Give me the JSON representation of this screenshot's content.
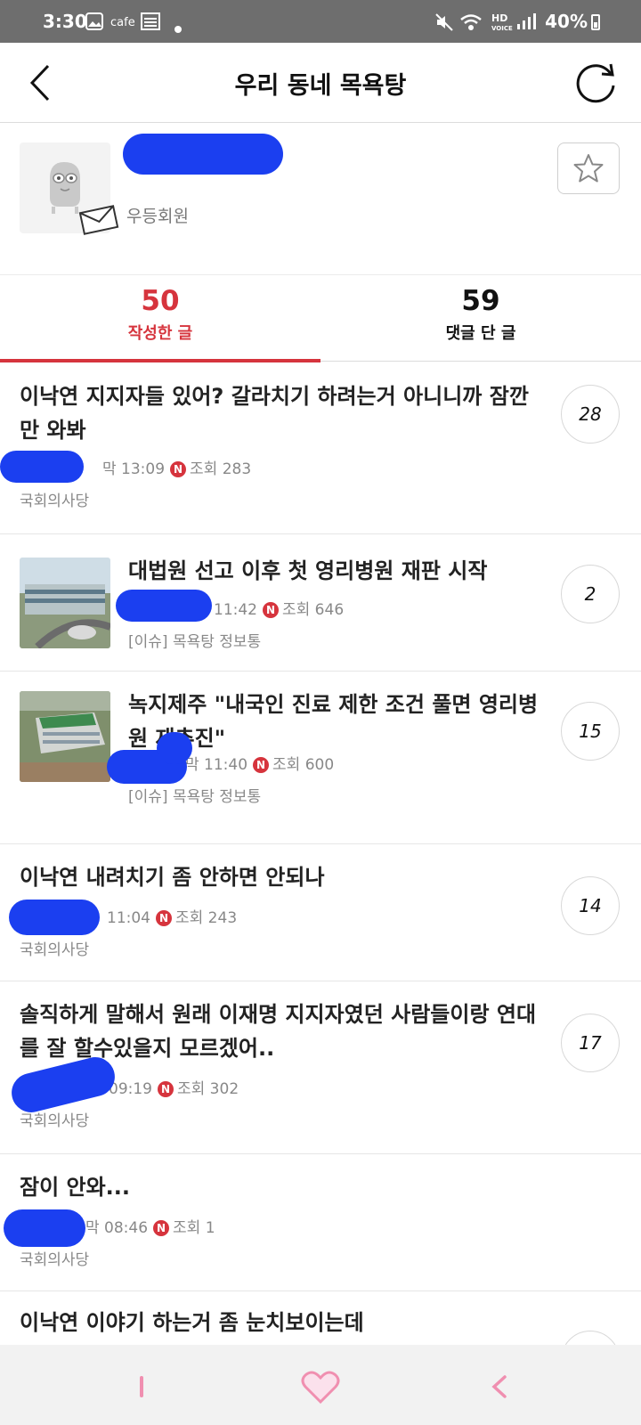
{
  "status_bar": {
    "time": "3:30",
    "app_label": "cafe",
    "battery": "40%"
  },
  "header": {
    "title": "우리 동네 목욕탕"
  },
  "profile": {
    "member_grade": "우등회원"
  },
  "tabs": [
    {
      "count": "50",
      "label": "작성한 글",
      "active": true
    },
    {
      "count": "59",
      "label": "댓글 단 글",
      "active": false
    }
  ],
  "posts": [
    {
      "title": "이낙연 지지자들 있어? 갈라치기 하려는거 아니니까 잠깐만 와봐",
      "time": "막 13:09",
      "views": "조회 283",
      "board": "국회의사당",
      "comments": "28"
    },
    {
      "title": "대법원 선고 이후 첫 영리병원 재판 시작",
      "time": "11:42",
      "views": "조회 646",
      "board": "[이슈] 목욕탕 정보통",
      "comments": "2"
    },
    {
      "title": "녹지제주 \"내국인 진료 제한 조건 풀면 영리병원 재추진\"",
      "time": "막 11:40",
      "views": "조회 600",
      "board": "[이슈] 목욕탕 정보통",
      "comments": "15"
    },
    {
      "title": "이낙연 내려치기 좀 안하면 안되나",
      "time": "11:04",
      "views": "조회 243",
      "board": "국회의사당",
      "comments": "14"
    },
    {
      "title": "솔직하게 말해서 원래 이재명 지지자였던 사람들이랑 연대를 잘 할수있을지 모르겠어..",
      "time": "09:19",
      "views": "조회 302",
      "board": "국회의사당",
      "comments": "17"
    },
    {
      "title": "잠이 안와...",
      "time": "막 08:46",
      "views": "조회 1",
      "board": "국회의사당",
      "comments": ""
    },
    {
      "title": "이낙연 이야기 하는거 좀 눈치보이는데",
      "time": "",
      "views": "",
      "board": "",
      "comments": ""
    }
  ],
  "icons": {
    "back": "chevron-left-icon",
    "refresh": "refresh-icon",
    "favorite": "star-icon",
    "mail": "mail-icon",
    "nav_recent": "recent-apps-icon",
    "nav_home": "heart-home-icon",
    "nav_back": "back-icon"
  },
  "colors": {
    "accent": "#d6343d",
    "redaction": "#1b3ff0",
    "nav_pink": "#f08fb0"
  }
}
